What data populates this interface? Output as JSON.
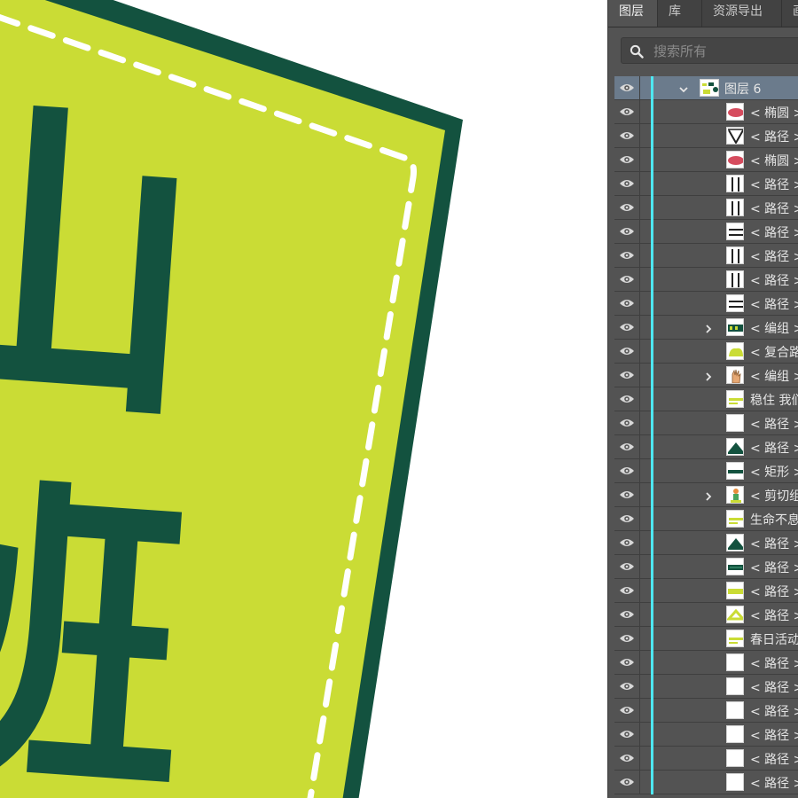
{
  "canvas": {
    "colors": {
      "outer_border": "#13523f",
      "fill": "#cadc35",
      "stitch": "#ffffff",
      "glyph": "#13523f"
    },
    "glyphs": [
      "山",
      "班"
    ]
  },
  "panel": {
    "tabs": [
      {
        "label": "图层",
        "active": true
      },
      {
        "label": "库",
        "active": false
      },
      {
        "label": "资源导出",
        "active": false
      },
      {
        "label": "画",
        "active": false
      }
    ],
    "search": {
      "placeholder": "搜索所有",
      "value": ""
    },
    "accent_color": "#4ee7f1",
    "rows": [
      {
        "type": "layer",
        "label": "图层 6",
        "expand": "down",
        "thumb": "collage",
        "selected": true
      },
      {
        "type": "item",
        "label": "< 椭圆 >",
        "thumb": "ellipse-red"
      },
      {
        "type": "item",
        "label": "< 路径 >",
        "thumb": "check"
      },
      {
        "type": "item",
        "label": "< 椭圆 >",
        "thumb": "ellipse-red"
      },
      {
        "type": "item",
        "label": "< 路径 >",
        "thumb": "vbar"
      },
      {
        "type": "item",
        "label": "< 路径 >",
        "thumb": "vbar"
      },
      {
        "type": "item",
        "label": "< 路径 >",
        "thumb": "hbar"
      },
      {
        "type": "item",
        "label": "< 路径 >",
        "thumb": "vbar"
      },
      {
        "type": "item",
        "label": "< 路径 >",
        "thumb": "vbar"
      },
      {
        "type": "item",
        "label": "< 路径 >",
        "thumb": "hbar"
      },
      {
        "type": "item",
        "label": "< 编组 >",
        "expand": "right",
        "thumb": "text-green"
      },
      {
        "type": "item",
        "label": "< 复合路径 >",
        "thumb": "blob-lime"
      },
      {
        "type": "item",
        "label": "< 编组 >",
        "expand": "right",
        "thumb": "hand"
      },
      {
        "type": "item",
        "label": "稳住 我们能赢",
        "thumb": "text-lime"
      },
      {
        "type": "item",
        "label": "< 路径 >",
        "thumb": "blank"
      },
      {
        "type": "item",
        "label": "< 路径 >",
        "thumb": "mountain"
      },
      {
        "type": "item",
        "label": "< 矩形 >",
        "thumb": "rect-green"
      },
      {
        "type": "item",
        "label": "< 剪切组 >",
        "expand": "right",
        "thumb": "figure"
      },
      {
        "type": "item",
        "label": "生命不息",
        "thumb": "text-lime"
      },
      {
        "type": "item",
        "label": "< 路径 >",
        "thumb": "mountain"
      },
      {
        "type": "item",
        "label": "< 路径 >",
        "thumb": "band-green"
      },
      {
        "type": "item",
        "label": "< 路径 >",
        "thumb": "band-lime"
      },
      {
        "type": "item",
        "label": "< 路径 >",
        "thumb": "tri-lime"
      },
      {
        "type": "item",
        "label": "春日活动",
        "thumb": "text-lime"
      },
      {
        "type": "item",
        "label": "< 路径 >",
        "thumb": "blank"
      },
      {
        "type": "item",
        "label": "< 路径 >",
        "thumb": "blank"
      },
      {
        "type": "item",
        "label": "< 路径 >",
        "thumb": "blank"
      },
      {
        "type": "item",
        "label": "< 路径 >",
        "thumb": "blank"
      },
      {
        "type": "item",
        "label": "< 路径 >",
        "thumb": "blank"
      },
      {
        "type": "item",
        "label": "< 路径 >",
        "thumb": "blank"
      }
    ]
  }
}
